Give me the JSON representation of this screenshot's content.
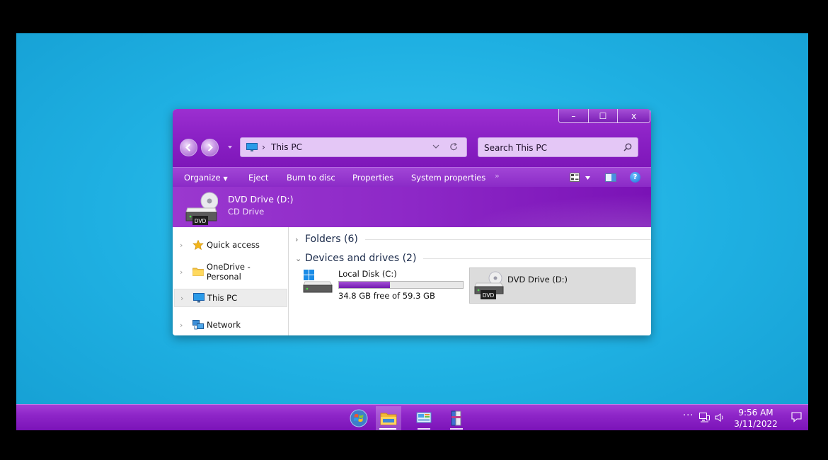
{
  "window": {
    "address": {
      "crumb": "This PC",
      "chevron": "›"
    },
    "search": {
      "placeholder": "Search This PC"
    },
    "caption": {
      "minimize": "–",
      "maximize": "☐",
      "close": "x"
    },
    "toolbar": {
      "organize": "Organize",
      "eject": "Eject",
      "burn": "Burn to disc",
      "properties": "Properties",
      "system_properties": "System properties",
      "more": "»"
    },
    "details": {
      "name": "DVD Drive (D:)",
      "type": "CD Drive"
    },
    "nav": {
      "items": [
        {
          "label": "Quick access",
          "icon": "star-icon"
        },
        {
          "label": "OneDrive - Personal",
          "icon": "folder-icon"
        },
        {
          "label": "This PC",
          "icon": "computer-icon",
          "selected": true
        },
        {
          "label": "Network",
          "icon": "network-icon"
        }
      ]
    },
    "content": {
      "folders_group": "Folders (6)",
      "devices_group": "Devices and drives (2)",
      "drive_c": {
        "name": "Local Disk (C:)",
        "free_text": "34.8 GB free of 59.3 GB",
        "used_fraction": 0.41
      },
      "drive_d": {
        "name": "DVD Drive (D:)",
        "label": "DVD"
      }
    },
    "dvd_badge": "DVD"
  },
  "taskbar": {
    "apps": [
      "start-orb",
      "file-explorer",
      "control-panel",
      "winrar"
    ],
    "tray_more": "···",
    "time": "9:56 AM",
    "date": "3/11/2022"
  },
  "colors": {
    "accent": "#8c22c6",
    "desktop": "#1fb0e2",
    "progress": "#8a2dc4"
  }
}
